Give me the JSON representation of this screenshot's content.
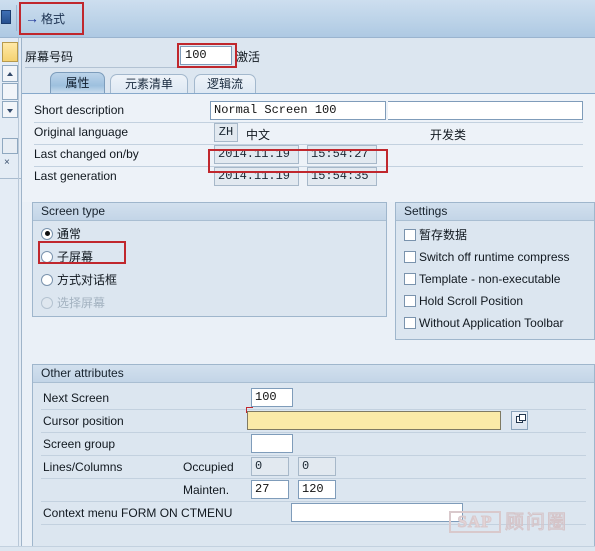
{
  "toolbar": {
    "format_button_label": "格式",
    "format_arrow_icon": "→"
  },
  "header": {
    "screen_number_label": "屏幕号码",
    "screen_number_value": "100",
    "status_label": "激活"
  },
  "tabs": [
    {
      "label": "属性",
      "active": true
    },
    {
      "label": "元素清单",
      "active": false
    },
    {
      "label": "逻辑流",
      "active": false
    }
  ],
  "attributes": {
    "short_description": {
      "label": "Short description",
      "value": "Normal Screen 100"
    },
    "original_language": {
      "label": "Original language",
      "code": "ZH",
      "name": "中文"
    },
    "development_class": {
      "label": "开发类"
    },
    "last_changed": {
      "label": "Last changed on/by",
      "date": "2014.11.19",
      "time": "15:54:27"
    },
    "last_generation": {
      "label": "Last generation",
      "date": "2014.11.19",
      "time": "15:54:35"
    }
  },
  "screen_type": {
    "title": "Screen type",
    "options": [
      {
        "label": "通常",
        "checked": true,
        "disabled": false
      },
      {
        "label": "子屏幕",
        "checked": false,
        "disabled": false
      },
      {
        "label": "方式对话框",
        "checked": false,
        "disabled": false
      },
      {
        "label": "选择屏幕",
        "checked": false,
        "disabled": true
      }
    ]
  },
  "settings": {
    "title": "Settings",
    "options": [
      {
        "label": "暂存数据",
        "checked": false
      },
      {
        "label": "Switch off runtime compress",
        "checked": false
      },
      {
        "label": "Template - non-executable",
        "checked": false
      },
      {
        "label": "Hold Scroll Position",
        "checked": false
      },
      {
        "label": "Without Application Toolbar",
        "checked": false
      }
    ]
  },
  "other_attributes": {
    "title": "Other attributes",
    "next_screen": {
      "label": "Next Screen",
      "value": "100"
    },
    "cursor_position": {
      "label": "Cursor position",
      "value": "",
      "picker_icon": "multi-select-icon"
    },
    "screen_group": {
      "label": "Screen group",
      "value": ""
    },
    "lines_columns": {
      "label": "Lines/Columns",
      "occupied_label": "Occupied",
      "occupied_lines": "0",
      "occupied_columns": "0",
      "mainten_label": "Mainten.",
      "mainten_lines": "27",
      "mainten_columns": "120"
    },
    "context_menu": {
      "label": "Context menu FORM ON CTMENU",
      "value": ""
    }
  },
  "watermark": {
    "logo_text": "SAP",
    "text": "顾问圈"
  },
  "colors": {
    "background": "#dce6f0",
    "highlight_box": "#c0272d",
    "focus_field": "#fbeaa8",
    "tab_active": "#9dc0de"
  }
}
